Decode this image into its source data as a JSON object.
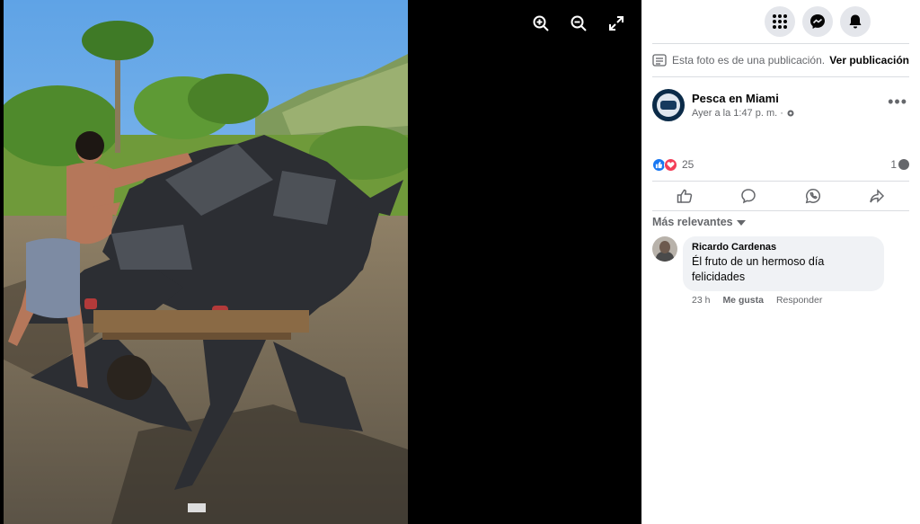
{
  "viewer": {
    "photo_alt": "",
    "tools": [
      "zoom-in-icon",
      "zoom-out-icon",
      "fullscreen-icon"
    ]
  },
  "topbar": {
    "buttons": [
      "menu-grid-icon",
      "messenger-icon",
      "bell-icon"
    ]
  },
  "notice": {
    "text": "Esta foto es de una publicación.",
    "link": "Ver publicación"
  },
  "post": {
    "page_name": "Pesca en Miami",
    "time": "Ayer a la 1:47 p. m. ·",
    "more": "•••"
  },
  "reactions": {
    "count": "25",
    "comments_count": "1"
  },
  "actions": [
    "like-icon",
    "comment-icon",
    "whatsapp-icon",
    "share-icon"
  ],
  "comments": {
    "sort_label": "Más relevantes",
    "items": [
      {
        "author": "Ricardo Cardenas",
        "text": "Él fruto de un hermoso día felicidades",
        "time": "23 h",
        "like": "Me gusta",
        "reply": "Responder"
      }
    ]
  },
  "colors": {
    "accent": "#1877f2",
    "love": "#f33e58",
    "secondary_text": "#65676b",
    "bubble_bg": "#f0f2f5"
  }
}
